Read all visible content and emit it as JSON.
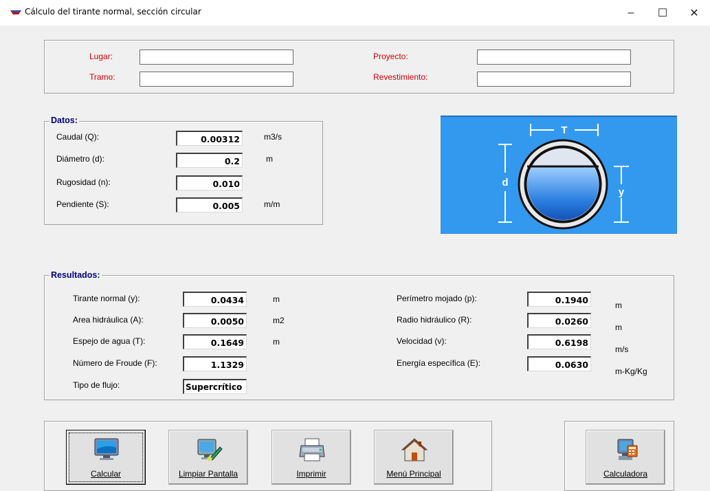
{
  "window": {
    "title": "Cálculo del tirante normal, sección circular",
    "minimize_glyph": "–",
    "maximize_glyph": "☐",
    "close_glyph": "✕"
  },
  "header_fields": {
    "lugar": {
      "label": "Lugar:",
      "value": ""
    },
    "tramo": {
      "label": "Tramo:",
      "value": ""
    },
    "proyecto": {
      "label": "Proyecto:",
      "value": ""
    },
    "revestimiento": {
      "label": "Revestimiento:",
      "value": ""
    }
  },
  "datos": {
    "legend": "Datos:",
    "caudal": {
      "label": "Caudal (Q):",
      "value": "0.00312",
      "unit": "m3/s"
    },
    "diametro": {
      "label": "Diámetro (d):",
      "value": "0.2",
      "unit": "m"
    },
    "rugosidad": {
      "label": "Rugosidad (n):",
      "value": "0.010",
      "unit": ""
    },
    "pendiente": {
      "label": "Pendiente (S):",
      "value": "0.005",
      "unit": "m/m"
    }
  },
  "diagram": {
    "label_T": "T",
    "label_d": "d",
    "label_y": "y",
    "colors": {
      "background": "#3399ee",
      "water": "#2a7fe0"
    }
  },
  "resultados": {
    "legend": "Resultados:",
    "left": [
      {
        "label": "Tirante normal (y):",
        "value": "0.0434",
        "unit": "m"
      },
      {
        "label": "Area hidráulica (A):",
        "value": "0.0050",
        "unit": "m2"
      },
      {
        "label": "Espejo de agua (T):",
        "value": "0.1649",
        "unit": "m"
      },
      {
        "label": "Número de Froude (F):",
        "value": "1.1329",
        "unit": ""
      },
      {
        "label": "Tipo de flujo:",
        "value": "Supercrítico",
        "unit": ""
      }
    ],
    "right": [
      {
        "label": "Perímetro mojado (p):",
        "value": "0.1940",
        "unit": "m"
      },
      {
        "label": "Radio hidráulico (R):",
        "value": "0.0260",
        "unit": "m"
      },
      {
        "label": "Velocidad (v):",
        "value": "0.6198",
        "unit": "m/s"
      },
      {
        "label": "Energía específica (E):",
        "value": "0.0630",
        "unit": "m-Kg/Kg"
      }
    ]
  },
  "buttons": {
    "calcular": {
      "label": "Calcular",
      "icon": "computer-monitor-icon"
    },
    "limpiar": {
      "label": "Limpiar Pantalla",
      "icon": "monitor-brush-icon"
    },
    "imprimir": {
      "label": "Imprimir",
      "icon": "printer-icon"
    },
    "menu": {
      "label": "Menú Principal",
      "icon": "house-icon"
    },
    "calculadora": {
      "label": "Calculadora",
      "icon": "calculator-icon"
    }
  }
}
